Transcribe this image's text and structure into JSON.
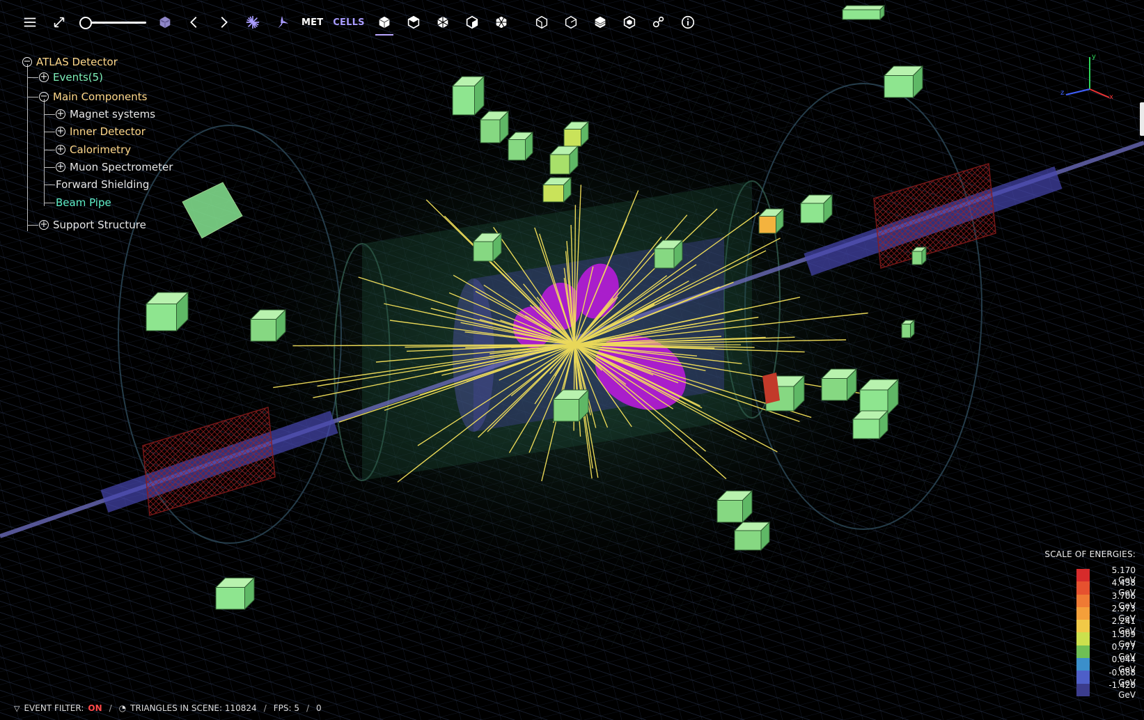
{
  "toolbar": {
    "met_label": "MET",
    "cells_label": "CELLS",
    "icons": [
      "menu-icon",
      "fullscreen-icon",
      "zoom-slider",
      "geometry-clipping-icon",
      "previous-event-icon",
      "next-event-icon",
      "overlay-collision-icon",
      "perspective-icon",
      "met-label",
      "cells-label",
      "view-cube-1",
      "view-cube-2",
      "view-cube-3",
      "view-cube-4",
      "view-cube-5",
      "view-cube-6",
      "view-cube-7",
      "view-cube-8",
      "view-cube-9",
      "settings-icon",
      "info-icon"
    ]
  },
  "tree": {
    "root": "ATLAS Detector",
    "events": "Events(5)",
    "main_components": "Main Components",
    "magnet_systems": "Magnet systems",
    "inner_detector": "Inner Detector",
    "calorimetry": "Calorimetry",
    "muon_spectrometer": "Muon Spectrometer",
    "forward_shielding": "Forward Shielding",
    "beam_pipe": "Beam Pipe",
    "support_structure": "Support Structure",
    "colors": {
      "root": "#ffd88a",
      "events": "#7ff0b8",
      "main": "#ffd88a",
      "inner": "#ffd88a",
      "calorimetry": "#ffd88a",
      "beam": "#5ff0c8",
      "default": "#e6e6e6"
    }
  },
  "axes": {
    "x": "x",
    "y": "y",
    "z": "z"
  },
  "scale": {
    "title": "SCALE OF ENERGIES:",
    "entries": [
      {
        "label": "5.170 GeV",
        "color": "#d62b2b"
      },
      {
        "label": "4.438 GeV",
        "color": "#e6512f"
      },
      {
        "label": "3.706 GeV",
        "color": "#ef7a34"
      },
      {
        "label": "2.973 GeV",
        "color": "#f49f3a"
      },
      {
        "label": "2.241 GeV",
        "color": "#f1c947"
      },
      {
        "label": "1.509 GeV",
        "color": "#cbe04d"
      },
      {
        "label": "0.777 GeV",
        "color": "#6fbf55"
      },
      {
        "label": "0.044 GeV",
        "color": "#3b8fcb"
      },
      {
        "label": "-0.688 GeV",
        "color": "#4e5fc8"
      },
      {
        "label": "-1.420 GeV",
        "color": "#3b3c8c"
      }
    ]
  },
  "status": {
    "event_filter_label": "EVENT FILTER:",
    "event_filter_value": "ON",
    "triangles_label": "TRIANGLES IN SCENE: 110824",
    "fps_label": "FPS: 5",
    "counter": "0"
  },
  "colors": {
    "track": "#f3e05a",
    "jet": "#b51cd6",
    "cell": "#7fd98a",
    "active_underline": "#b9a6ff",
    "accent_purple": "#a99cff"
  }
}
